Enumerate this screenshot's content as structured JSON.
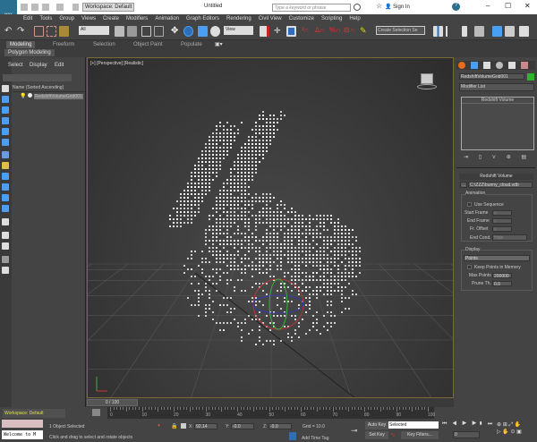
{
  "title": {
    "app": "MAX",
    "workspace": "Workspace: Default",
    "doc": "Untitled",
    "search_placeholder": "Type a keyword or phrase",
    "sign_in": "Sign In"
  },
  "menu": [
    "Edit",
    "Tools",
    "Group",
    "Views",
    "Create",
    "Modifiers",
    "Animation",
    "Graph Editors",
    "Rendering",
    "Civil View",
    "Customize",
    "Scripting",
    "Help"
  ],
  "toolbar": {
    "filter": "All",
    "ref_coord": "View",
    "selection_set": "Create Selection Se"
  },
  "ribbon": {
    "tabs": [
      "Modeling",
      "Freeform",
      "Selection",
      "Object Paint",
      "Populate"
    ],
    "sub": "Polygon Modeling"
  },
  "explorer": {
    "tabs": [
      "Select",
      "Display",
      "Edit"
    ],
    "header": "Name (Sorted Ascending)",
    "item": "RedshiftVolumeGrid001"
  },
  "viewport": {
    "label": "[+] [Perspective] [Realistic]"
  },
  "panel": {
    "object_name": "RedshiftVolumeGrid001",
    "object_color": "#2db52d",
    "modifier_list": "Modifier List",
    "stack_item": "Redshift Volume",
    "rollout": "Redshift Volume",
    "file_btn": "...",
    "file": "C:\\ZZZ\\bunny_cloud.vdb",
    "anim_group": "Animation",
    "use_sequence": "Use Sequence",
    "start_frame": "Start Frame",
    "end_frame": "End Frame",
    "fr_offset": "Fr. Offset",
    "end_cond": "End Cond.",
    "end_cond_value": "Hide",
    "start_val": "0",
    "end_val": "0",
    "offset_val": "0",
    "display_group": "Display",
    "display_mode": "Points",
    "keep_points": "Keep Points in Memory",
    "max_points": "Max Points",
    "max_points_val": "200000",
    "prune": "Prune Th.",
    "prune_val": "0.0"
  },
  "timeline": {
    "slider": "0 / 100",
    "ticks": [
      "0",
      "10",
      "20",
      "30",
      "40",
      "50",
      "60",
      "70",
      "80",
      "90",
      "100"
    ]
  },
  "status": {
    "workspace": "Workspace: Default",
    "selected": "1 Object Selected",
    "prompt": "Click and drag to select and rotate objects",
    "x_label": "X:",
    "x": "92.14",
    "y_label": "Y:",
    "y": "-0.0",
    "z_label": "Z:",
    "z": "-0.0",
    "grid": "Grid = 10.0",
    "add_time_tag": "Add Time Tag",
    "auto_key": "Auto Key",
    "set_key": "Set Key",
    "key_mode": "Selected",
    "key_filters": "Key Filters...",
    "frame": "0",
    "maxscript": "Welcome to M"
  }
}
